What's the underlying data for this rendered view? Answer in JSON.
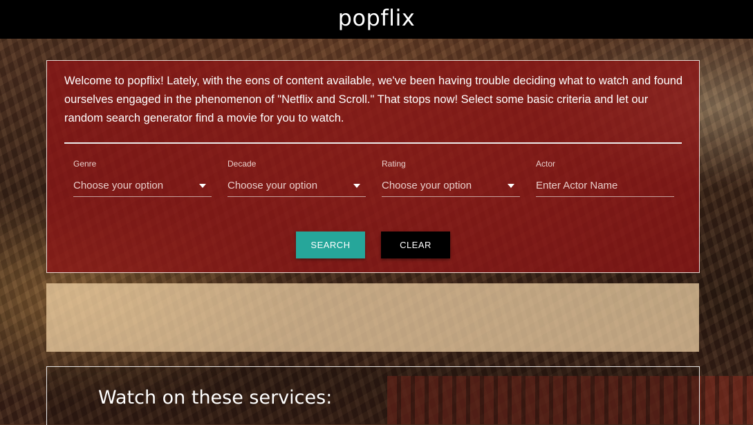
{
  "header": {
    "brand": "popflix"
  },
  "search_panel": {
    "intro": "Welcome to popflix! Lately, with the eons of content available, we've been having trouble deciding what to watch and found ourselves engaged in the phenomenon of \"Netflix and Scroll.\" That stops now! Select some basic criteria and let our random search generator find a movie for you to watch.",
    "fields": [
      {
        "label": "Genre",
        "value": "Choose your option",
        "icon": "chevron-down-icon"
      },
      {
        "label": "Decade",
        "value": "Choose your option",
        "icon": "chevron-down-icon"
      },
      {
        "label": "Rating",
        "value": "Choose your option",
        "icon": "chevron-down-icon"
      },
      {
        "label": "Actor",
        "placeholder": "Enter Actor Name"
      }
    ],
    "search_label": "SEARCH",
    "clear_label": "CLEAR",
    "colors": {
      "panel": "#8c1616",
      "search_button": "#26a69a",
      "clear_button": "#000000"
    }
  },
  "services": {
    "title": "Watch on these services:"
  }
}
